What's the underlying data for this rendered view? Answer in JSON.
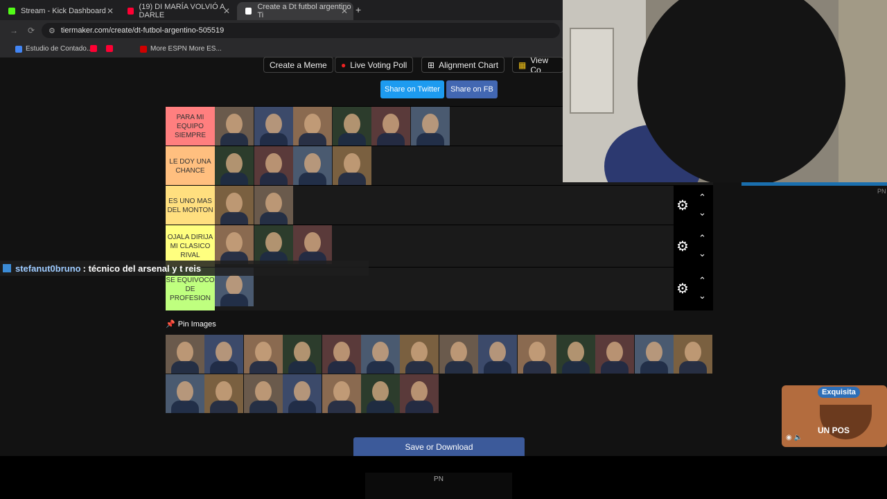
{
  "browser": {
    "tabs": [
      {
        "label": "Stream - Kick Dashboard",
        "color": "#53fc18"
      },
      {
        "label": "(19) DI MARÍA VOLVIÓ A DARLE",
        "color": "#ff0033"
      },
      {
        "label": "Create a Dt futbol argentino Ti",
        "color": "#ffffff"
      }
    ],
    "url": "tiermaker.com/create/dt-futbol-argentino-505519",
    "bookmarks": [
      {
        "label": "Estudio de Contado...",
        "color": "#4285f4"
      },
      {
        "label": "",
        "color": "#ff0033"
      },
      {
        "label": "",
        "color": "#ff0033"
      },
      {
        "label": "More ESPN More ES...",
        "color": "#d00000"
      }
    ]
  },
  "toolbar": {
    "buttons": [
      "Create a Meme",
      "Live Voting Poll",
      "Alignment Chart",
      "View Co"
    ],
    "share_twitter": "Share on Twitter",
    "share_fb": "Share on FB"
  },
  "tiers": [
    {
      "label": "PARA MI EQUIPO SIEMPRE",
      "color": "#ff7f7f",
      "count": 6
    },
    {
      "label": "LE DOY UNA CHANCE",
      "color": "#ffbf7f",
      "count": 4
    },
    {
      "label": "ES UNO MAS DEL MONTON",
      "color": "#ffdf7f",
      "count": 2
    },
    {
      "label": "OJALA DIRIJA MI CLASICO RIVAL",
      "color": "#ffff7f",
      "count": 3
    },
    {
      "label": "SE EQUIVOCO DE PROFESION",
      "color": "#bfff7f",
      "count": 1
    }
  ],
  "pin_images_label": "Pin Images",
  "pool_counts": {
    "row1": 14,
    "row2": 7
  },
  "save_button": "Save or Download",
  "chat": {
    "user": "stefanut0bruno",
    "message": ": técnico del arsenal y t reis"
  },
  "ad": {
    "brand": "Exquisita",
    "slogan": "UN POS"
  },
  "overlay_pn": "PN"
}
